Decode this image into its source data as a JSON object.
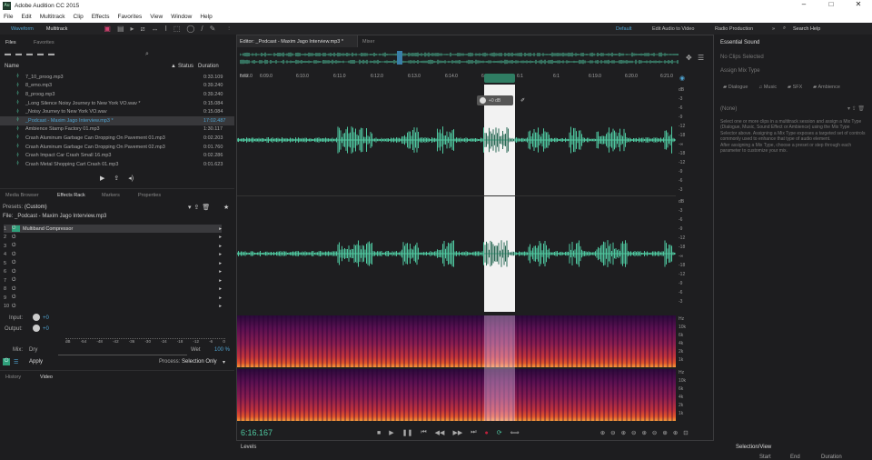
{
  "app": {
    "title": "Adobe Audition CC 2015",
    "logo": "Au"
  },
  "window_controls": [
    "minimize-icon",
    "maximize-icon",
    "close-icon"
  ],
  "menu": [
    "File",
    "Edit",
    "Multitrack",
    "Clip",
    "Effects",
    "Favorites",
    "View",
    "Window",
    "Help"
  ],
  "toolbar": {
    "waveform": "Waveform",
    "multitrack": "Multitrack",
    "workspaces": [
      "Default",
      "Edit Audio to Video",
      "Radio Production"
    ],
    "more": "»",
    "search": "Search Help"
  },
  "files": {
    "tabs": [
      "Files",
      "Favorites"
    ],
    "columns": {
      "name": "Name",
      "status": "Status",
      "duration": "Duration"
    },
    "items": [
      {
        "name": "7_10_proog.mp3",
        "duration": "0:33.109"
      },
      {
        "name": "8_emo.mp3",
        "duration": "0:39.240"
      },
      {
        "name": "8_proog.mp3",
        "duration": "0:39.240"
      },
      {
        "name": "_Long Silence Noisy Journey to New York VO.wav *",
        "duration": "0:15.084"
      },
      {
        "name": "_Noisy Journey to New York VO.wav",
        "duration": "0:15.084"
      },
      {
        "name": "_Podcast - Maxim Jago Interview.mp3 *",
        "duration": "17:02.487",
        "selected": true
      },
      {
        "name": "Ambience Stamp Factory 01.mp3",
        "duration": "1:30.117"
      },
      {
        "name": "Crash Aluminum Garbage Can Dropping On Pavement 01.mp3",
        "duration": "0:02.203"
      },
      {
        "name": "Crash Aluminum Garbage Can Dropping On Pavement 02.mp3",
        "duration": "0:01.760"
      },
      {
        "name": "Crash Impact Car Crash Small 16.mp3",
        "duration": "0:02.286"
      },
      {
        "name": "Crash Metal Shopping Cart Crash 01.mp3",
        "duration": "0:01.623"
      }
    ]
  },
  "effects_rack": {
    "tabs": [
      "Media Browser",
      "Effects Rack",
      "Markers",
      "Properties"
    ],
    "presets_label": "Presets:",
    "preset": "(Custom)",
    "file": "File: _Podcast - Maxim Jago Interview.mp3",
    "slots": [
      {
        "n": "1",
        "effect": "Multiband Compressor"
      },
      {
        "n": "2",
        "effect": ""
      },
      {
        "n": "3",
        "effect": ""
      },
      {
        "n": "4",
        "effect": ""
      },
      {
        "n": "5",
        "effect": ""
      },
      {
        "n": "6",
        "effect": ""
      },
      {
        "n": "7",
        "effect": ""
      },
      {
        "n": "8",
        "effect": ""
      },
      {
        "n": "9",
        "effect": ""
      },
      {
        "n": "10",
        "effect": ""
      }
    ],
    "input_label": "Input:",
    "input_value": "+0",
    "output_label": "Output:",
    "output_value": "+0",
    "meter_ticks": [
      "dB",
      "-54",
      "-48",
      "-42",
      "-36",
      "-30",
      "-24",
      "-18",
      "-12",
      "-6",
      "0"
    ],
    "mix_label": "Mix:",
    "dry": "Dry",
    "wet": "Wet",
    "wet_pct": "100 %",
    "apply": "Apply",
    "process_label": "Process:",
    "process": "Selection Only"
  },
  "bottom_left_tabs": [
    "History",
    "Video"
  ],
  "editor": {
    "tab": "Editor: _Podcast - Maxim Jago Interview.mp3 *",
    "mixer_tab": "Mixer",
    "ruler": [
      "hms",
      "6:09.0",
      "6:10.0",
      "6:11.0",
      "6:12.0",
      "6:13.0",
      "6:14.0",
      "6:15.0",
      "6:1",
      "6:1",
      "6:19.0",
      "6:20.0",
      "6:21.0",
      "6:22.0"
    ],
    "hud_gain": "+0 dB",
    "db_scale": [
      "dB",
      "-3",
      "-6",
      "-9",
      "-12",
      "-18",
      "-∞",
      "-18",
      "-12",
      "-9",
      "-6",
      "-3"
    ],
    "hz_scale": [
      "Hz",
      "10k",
      "6k",
      "4k",
      "2k",
      "1k"
    ],
    "time": "6:16.167",
    "waveform_color": "#4fc79f"
  },
  "levels": {
    "label": "Levels"
  },
  "essential_sound": {
    "title": "Essential Sound",
    "status": "No Clips Selected",
    "assign": "Assign Mix Type",
    "types": [
      "Dialogue",
      "Music",
      "SFX",
      "Ambience"
    ],
    "preset": "(None)",
    "help": "Select one or more clips in a multitrack session and assign a Mix Type (Dialogue, Music, Sound Effect or Ambience) using the Mix Type Selector above. Assigning a Mix Type exposes a targeted set of controls commonly used to enhance that type of audio element.",
    "help2": "After assigning a Mix Type, choose a preset or step through each parameter to customize your mix."
  },
  "selection_view": {
    "title": "Selection/View",
    "cols": [
      "Start",
      "End",
      "Duration"
    ]
  }
}
